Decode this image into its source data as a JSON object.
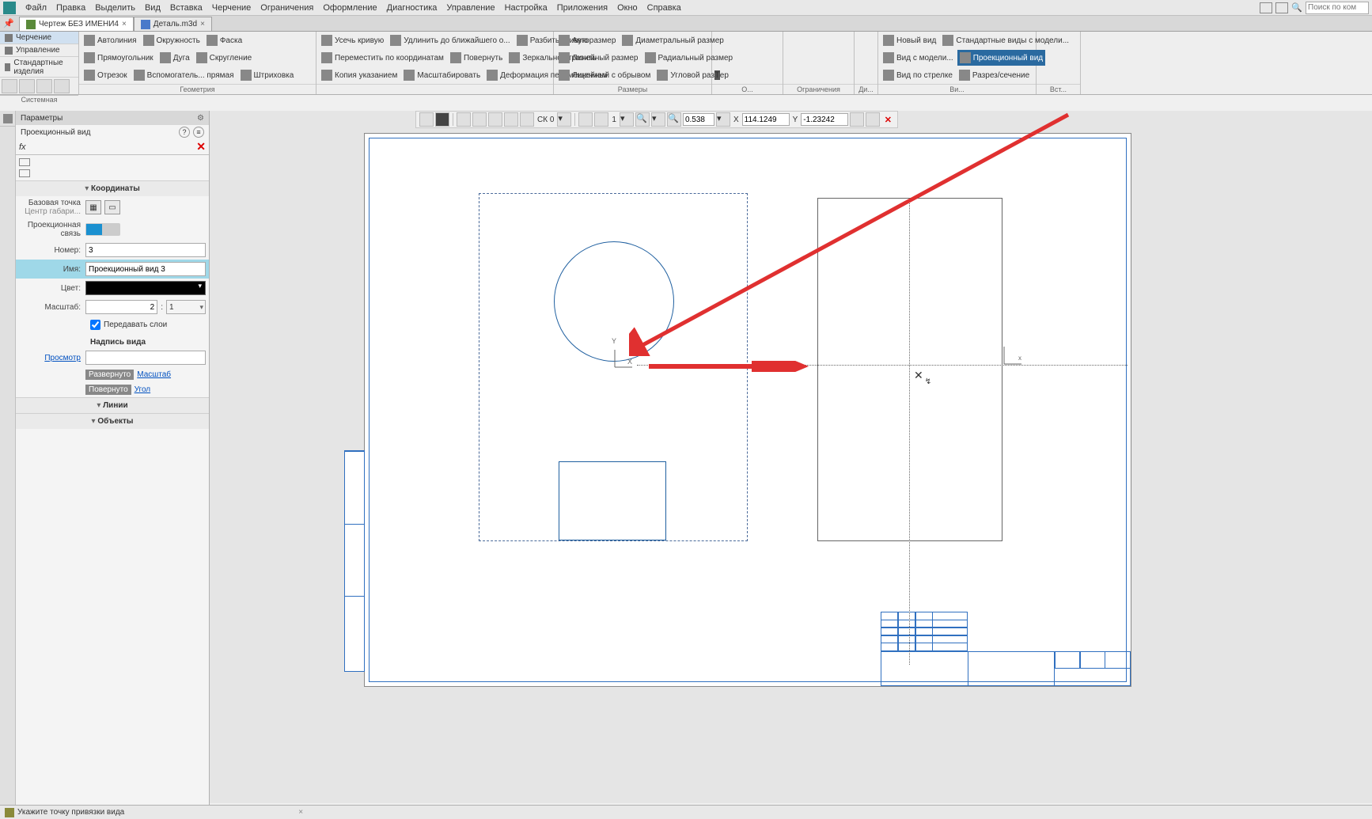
{
  "menu": [
    "Файл",
    "Правка",
    "Выделить",
    "Вид",
    "Вставка",
    "Черчение",
    "Ограничения",
    "Оформление",
    "Диагностика",
    "Управление",
    "Настройка",
    "Приложения",
    "Окно",
    "Справка"
  ],
  "search_ph": "Поиск по ком",
  "tabs": [
    {
      "label": "Чертеж БЕЗ ИМЕНИ4",
      "active": true
    },
    {
      "label": "Деталь.m3d",
      "active": false
    }
  ],
  "modes": {
    "a": "Черчение",
    "b": "Управление",
    "c": "Стандартные изделия",
    "grp": "Системная"
  },
  "ribbon": {
    "geom_rows": [
      [
        "Автолиния",
        "Окружность",
        "Фаска"
      ],
      [
        "Прямоугольник",
        "Дуга",
        "Скругление"
      ],
      [
        "Отрезок",
        "Вспомогатель...\nпрямая",
        "Штриховка"
      ]
    ],
    "geom_lbl": "Геометрия",
    "edit_rows": [
      [
        "Усечь кривую",
        "Удлинить до\nближайшего о...",
        "Разбить кривую"
      ],
      [
        "Переместить по\nкоординатам",
        "Повернуть",
        "Зеркально\nотразить"
      ],
      [
        "Копия\nуказанием",
        "Масштабировать",
        "Деформация\nперемещением"
      ]
    ],
    "dim_rows": [
      [
        "Авторазмер",
        "Диаметральный\nразмер"
      ],
      [
        "Линейный\nразмер",
        "Радиальный\nразмер"
      ],
      [
        "Линейный с\nобрывом",
        "Угловой размер"
      ]
    ],
    "dim_lbl": "Размеры",
    "con_lbl": "Ограничения",
    "views": [
      "Новый вид",
      "Стандартные\nвиды с модели...",
      "Вид с модели...",
      "Проекционный\nвид",
      "Вид по стрелке",
      "Разрез/сечение"
    ],
    "views_lbl": "Ви...",
    "ins_lbl": "Вст..."
  },
  "subbar": {
    "sk": "СК 0",
    "one": "1",
    "scale": "0.538",
    "xlbl": "X",
    "x": "114.1249",
    "ylbl": "Y",
    "y": "-1.23242"
  },
  "panel": {
    "title": "Параметры",
    "subtitle": "Проекционный вид",
    "group_coord": "Координаты",
    "base_l": "Базовая точка",
    "base_sub": "Центр габари...",
    "proj_l": "Проекционная\nсвязь",
    "num_l": "Номер:",
    "num_v": "3",
    "name_l": "Имя:",
    "name_v": "Проекционный вид 3",
    "color_l": "Цвет:",
    "scale_l": "Масштаб:",
    "scale_a": "2",
    "scale_b": "1",
    "layers": "Передавать слои",
    "caption": "Надпись вида",
    "preview": "Просмотр",
    "rot_a": "Развернуто",
    "rot_a_link": "Масштаб",
    "rot_b": "Повернуто",
    "rot_b_link": "Угол",
    "group_lines": "Линии",
    "group_obj": "Объекты"
  },
  "status": "Укажите точку привязки вида"
}
